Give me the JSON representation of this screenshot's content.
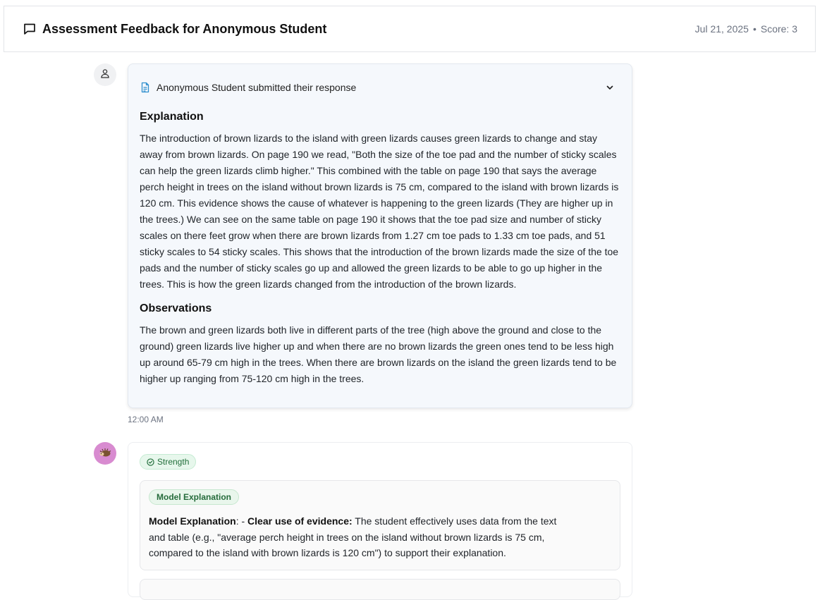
{
  "header": {
    "title": "Assessment Feedback for Anonymous Student",
    "date": "Jul 21, 2025",
    "separator": "•",
    "score": "Score: 3"
  },
  "response": {
    "submitted_text": "Anonymous Student submitted their response",
    "explanation_heading": "Explanation",
    "explanation_text": "The introduction of brown lizards to the island with green lizards causes green lizards to change and stay away from brown lizards. On page 190 we read, \"Both the size of the toe pad and the number of sticky scales can help the green lizards climb higher.\" This combined with the table on page 190 that says the average perch height in trees on the island without brown lizards is 75 cm, compared to the island with brown lizards is 120 cm. This evidence shows the cause of whatever is happening to the green lizards (They are higher up in the trees.) We can see on the same table on page 190 it shows that the toe pad size and number of sticky scales on there feet grow when there are brown lizards from 1.27 cm toe pads to 1.33 cm toe pads, and 51 sticky scales to 54 sticky scales. This shows that the introduction of the brown lizards made the size of the toe pads and the number of sticky scales go up and allowed the green lizards to be able to go up higher in the trees. This is how the green lizards changed from the introduction of the brown lizards.",
    "observations_heading": "Observations",
    "observations_text": "The brown and green lizards both live in different parts of the tree (high above the ground and close to the ground) green lizards live higher up and when there are no brown lizards the green ones tend to be less high up around 65-79 cm high in the trees. When there are brown lizards on the island the green lizards tend to be higher up ranging from 75-120 cm high in the trees.",
    "timestamp": "12:00 AM"
  },
  "feedback": {
    "strength_label": "Strength",
    "model_badge": "Model Explanation",
    "model_label": "Model Explanation",
    "model_colon": ": - ",
    "evidence_label": "Clear use of evidence:",
    "model_text": " The student effectively uses data from the text and table (e.g., \"average perch height in trees on the island without brown lizards is 75 cm, compared to the island with brown lizards is 120 cm\") to support their explanation."
  },
  "icons": {
    "header": "chat-bubble-icon",
    "user_avatar": "user-icon",
    "bot_avatar": "hedgehog-icon",
    "document": "document-icon",
    "collapse": "chevron-down-icon",
    "strength": "check-circle-icon"
  },
  "colors": {
    "card_bg": "#f5f8fc",
    "strength_bg": "#e7f7ec",
    "strength_text": "#216e3a",
    "bot_avatar_bg": "#d88bd0",
    "doc_icon": "#2f8fce"
  }
}
